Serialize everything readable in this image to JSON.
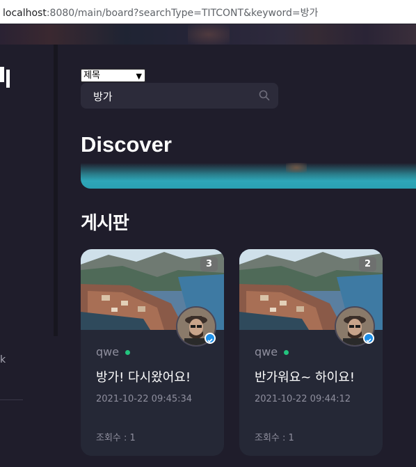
{
  "browser": {
    "url_host": "localhost",
    "url_rest": ":8080/main/board?searchType=TITCONT&keyword=방가"
  },
  "sidebar": {
    "partial_text": "k"
  },
  "search": {
    "select_value": "제목",
    "keyword": "방가"
  },
  "discover": {
    "title": "Discover"
  },
  "board": {
    "title": "게시판",
    "cards": [
      {
        "count": "3",
        "user": "qwe",
        "title": "방가! 다시왔어요!",
        "date": "2021-10-22 09:45:34",
        "views": "조회수 : 1"
      },
      {
        "count": "2",
        "user": "qwe",
        "title": "반가워요~ 하이요!",
        "date": "2021-10-22 09:44:12",
        "views": "조회수 : 1"
      }
    ]
  },
  "colors": {
    "background": "#1f1d2b",
    "card": "#252836",
    "accent_teal": "#2ea6b8",
    "online": "#23c47e",
    "verified": "#1d8fe8"
  }
}
